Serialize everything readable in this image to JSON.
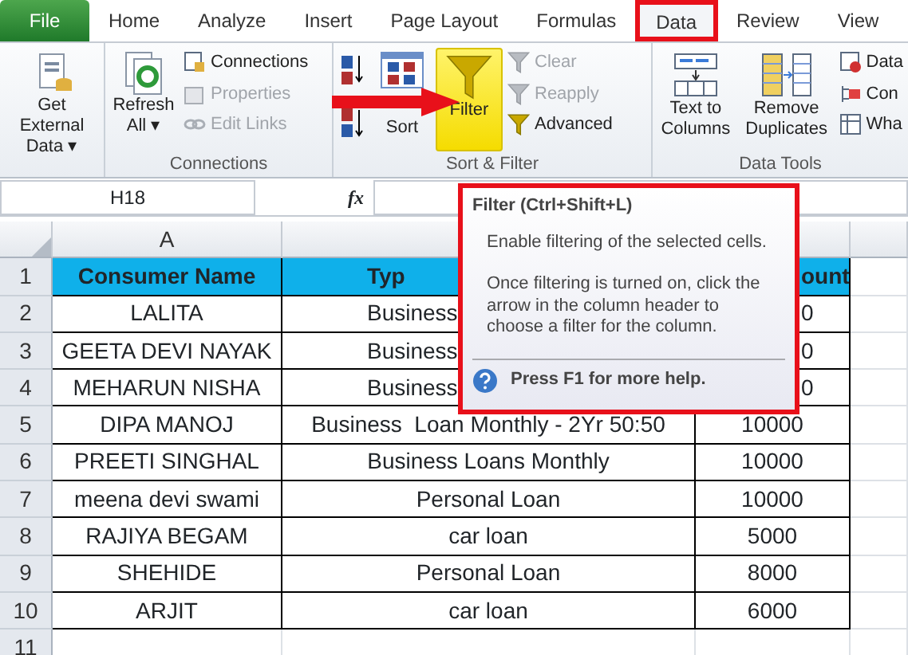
{
  "tabs": [
    {
      "label": "File",
      "kind": "file",
      "selected": false,
      "outlined": false
    },
    {
      "label": "Home",
      "kind": "tab",
      "selected": false,
      "outlined": false
    },
    {
      "label": "Analyze",
      "kind": "tab",
      "selected": false,
      "outlined": false
    },
    {
      "label": "Insert",
      "kind": "tab",
      "selected": false,
      "outlined": false
    },
    {
      "label": "Page Layout",
      "kind": "tab",
      "selected": false,
      "outlined": false
    },
    {
      "label": "Formulas",
      "kind": "tab",
      "selected": false,
      "outlined": false
    },
    {
      "label": "Data",
      "kind": "tab",
      "selected": true,
      "outlined": true
    },
    {
      "label": "Review",
      "kind": "tab",
      "selected": false,
      "outlined": false
    },
    {
      "label": "View",
      "kind": "tab",
      "selected": false,
      "outlined": false
    }
  ],
  "ribbon": [
    {
      "items": [
        {
          "kind": "large",
          "label": "Get External Data ▾",
          "disabled": false,
          "highlighted": false
        }
      ]
    },
    {
      "label": "Connections",
      "items": [
        {
          "kind": "large",
          "label": "Refresh All ▾",
          "disabled": false,
          "highlighted": false
        },
        {
          "kind": "small",
          "label": "Connections",
          "disabled": false
        },
        {
          "kind": "small",
          "label": "Properties",
          "disabled": true
        },
        {
          "kind": "small",
          "label": "Edit Links",
          "disabled": true
        }
      ]
    },
    {
      "label": "Sort & Filter",
      "items": [
        {
          "kind": "icon"
        },
        {
          "kind": "large",
          "label": "Sort",
          "disabled": false,
          "highlighted": false
        },
        {
          "kind": "large",
          "label": "Filter",
          "disabled": false,
          "highlighted": true
        },
        {
          "kind": "small",
          "label": "Clear",
          "disabled": true
        },
        {
          "kind": "small",
          "label": "Reapply",
          "disabled": true
        },
        {
          "kind": "small",
          "label": "Advanced",
          "disabled": false
        }
      ]
    },
    {
      "label": "Data Tools",
      "items": [
        {
          "kind": "large",
          "label": "Text to Columns",
          "disabled": false,
          "highlighted": false
        },
        {
          "kind": "large",
          "label": "Remove Duplicates",
          "disabled": false,
          "highlighted": false
        },
        {
          "kind": "small",
          "label": "Data",
          "disabled": false
        },
        {
          "kind": "small",
          "label": "Con",
          "disabled": false
        },
        {
          "kind": "small",
          "label": "Wha",
          "disabled": false
        }
      ]
    }
  ],
  "name_box": "H18",
  "fx": "fx",
  "columns": [
    {
      "label": "A"
    }
  ],
  "header_row": {
    "number": "1",
    "cells": [
      "Consumer Name",
      "Typ",
      "ount"
    ]
  },
  "rows": [
    {
      "number": "2",
      "cells": [
        "LALITA",
        "Business",
        "0"
      ]
    },
    {
      "number": "3",
      "cells": [
        "GEETA DEVI NAYAK",
        "Business",
        "0"
      ]
    },
    {
      "number": "4",
      "cells": [
        "MEHARUN NISHA",
        "Business",
        "0"
      ]
    },
    {
      "number": "5",
      "cells": [
        "DIPA MANOJ",
        "Business  Loan Monthly - 2Yr 50:50",
        "10000"
      ]
    },
    {
      "number": "6",
      "cells": [
        "PREETI SINGHAL",
        "Business Loans Monthly",
        "10000"
      ]
    },
    {
      "number": "7",
      "cells": [
        "meena devi swami",
        "Personal Loan",
        "10000"
      ]
    },
    {
      "number": "8",
      "cells": [
        "RAJIYA BEGAM",
        "car loan",
        "5000"
      ]
    },
    {
      "number": "9",
      "cells": [
        "SHEHIDE",
        "Personal Loan",
        "8000"
      ]
    },
    {
      "number": "10",
      "cells": [
        "ARJIT",
        "car loan",
        "6000"
      ]
    },
    {
      "number": "11",
      "cells": []
    }
  ],
  "tooltip": {
    "title": "Filter (Ctrl+Shift+L)",
    "paragraphs": [
      "Enable filtering of the selected cells.",
      "Once filtering is turned on, click the arrow in the column header to choose a filter for the column."
    ],
    "help": "Press F1 for more help.",
    "outlined": true
  }
}
